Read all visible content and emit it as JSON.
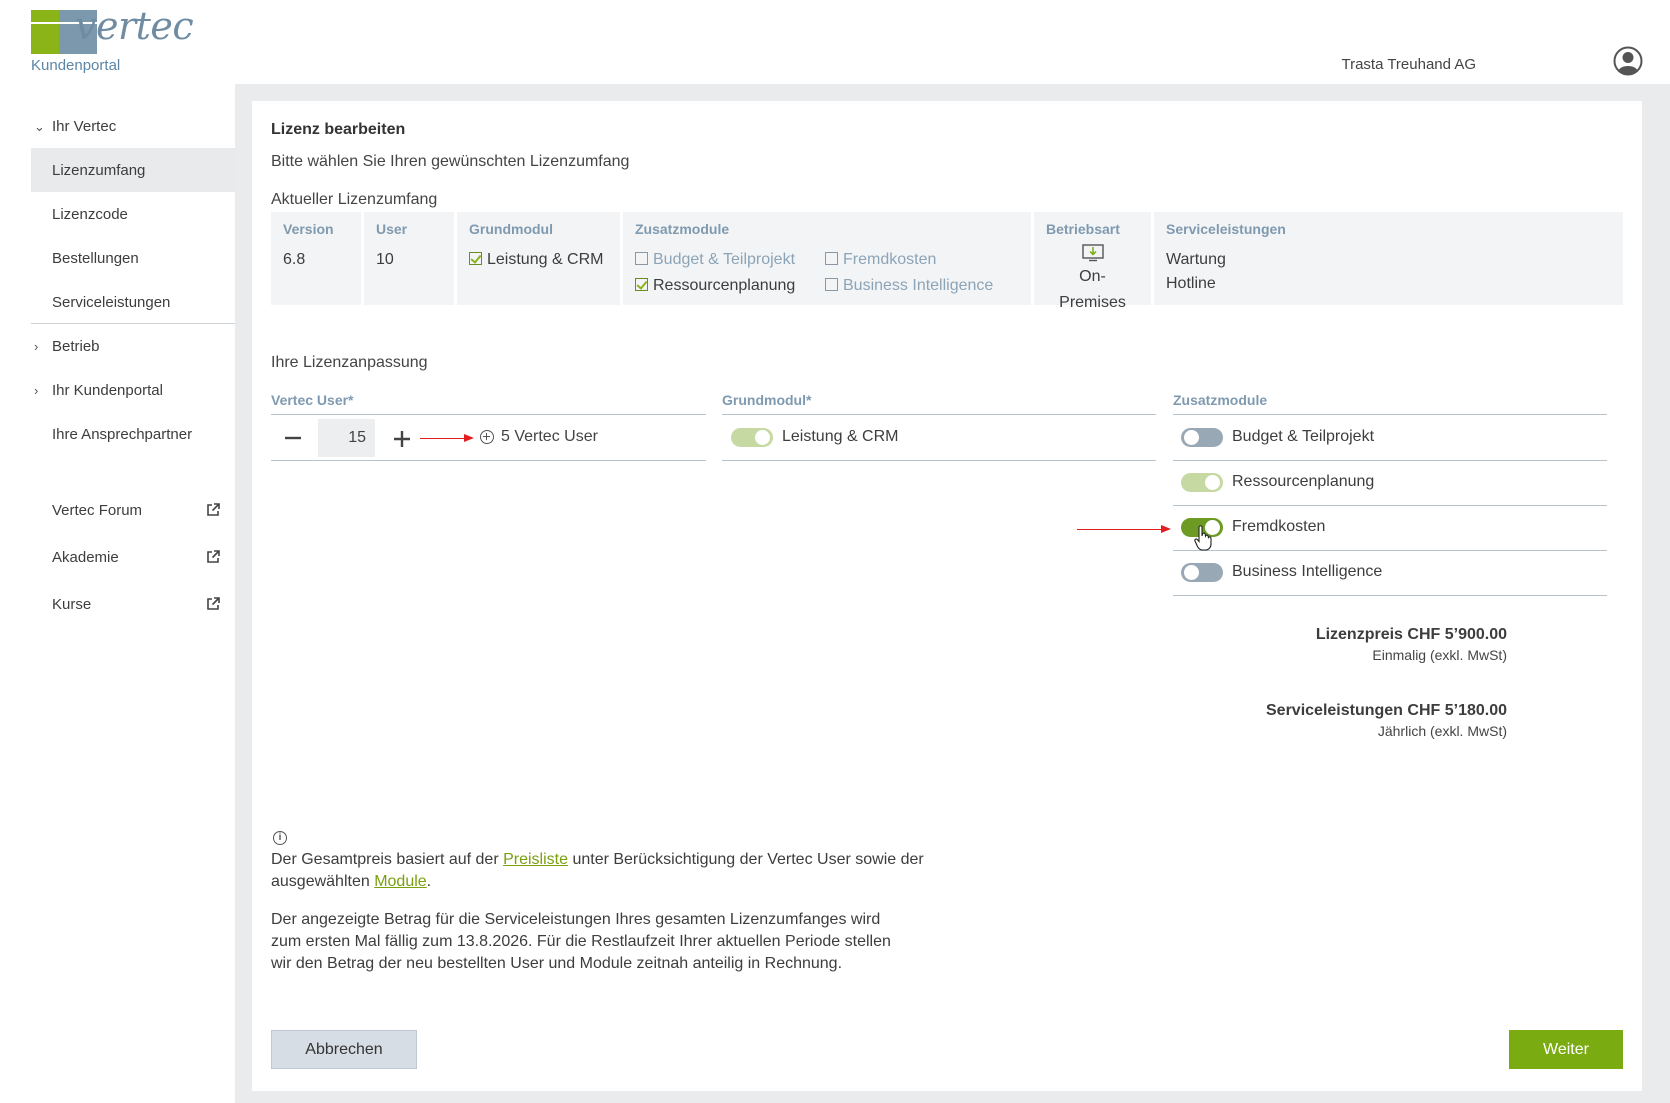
{
  "header": {
    "logo_word": "vertec",
    "portal_label": "Kundenportal",
    "company": "Trasta Treuhand AG"
  },
  "sidebar": {
    "group_ihr_vertec": "Ihr Vertec",
    "items": [
      {
        "label": "Lizenzumfang",
        "active": true
      },
      {
        "label": "Lizenzcode"
      },
      {
        "label": "Bestellungen"
      },
      {
        "label": "Serviceleistungen"
      }
    ],
    "group_betrieb": "Betrieb",
    "group_kundenportal": "Ihr Kundenportal",
    "ansprechpartner": "Ihre Ansprechpartner",
    "external": [
      {
        "label": "Vertec Forum",
        "icon": "external-link-icon"
      },
      {
        "label": "Akademie",
        "icon": "external-link-icon"
      },
      {
        "label": "Kurse",
        "icon": "external-link-icon"
      }
    ]
  },
  "main": {
    "title": "Lizenz bearbeiten",
    "subtitle": "Bitte wählen Sie Ihren gewünschten Lizenzumfang",
    "current_heading": "Aktueller Lizenzumfang",
    "current": {
      "version_label": "Version",
      "version": "6.8",
      "user_label": "User",
      "user": "10",
      "grundmodul_label": "Grundmodul",
      "grundmodul": "Leistung & CRM",
      "zusatz_label": "Zusatzmodule",
      "zusatz": [
        {
          "label": "Budget & Teilprojekt",
          "checked": false
        },
        {
          "label": "Fremdkosten",
          "checked": false
        },
        {
          "label": "Ressourcenplanung",
          "checked": true
        },
        {
          "label": "Business Intelligence",
          "checked": false
        }
      ],
      "betriebsart_label": "Betriebsart",
      "betriebsart": "On-Premises",
      "service_label": "Serviceleistungen",
      "service": [
        "Wartung",
        "Hotline"
      ]
    },
    "adjust_heading": "Ihre Lizenzanpassung",
    "col_user": "Vertec User*",
    "col_grund": "Grundmodul*",
    "col_zusatz": "Zusatzmodule",
    "user_count": "15",
    "user_delta": "5 Vertec User",
    "grund_toggle": "Leistung & CRM",
    "zusatz_toggles": [
      {
        "label": "Budget & Teilprojekt",
        "state": "off"
      },
      {
        "label": "Ressourcenplanung",
        "state": "on-disabled"
      },
      {
        "label": "Fremdkosten",
        "state": "on"
      },
      {
        "label": "Business Intelligence",
        "state": "off"
      }
    ],
    "license_price": "Lizenzpreis CHF 5’900.00",
    "license_price_note": "Einmalig (exkl. MwSt)",
    "service_price": "Serviceleistungen CHF 5’180.00",
    "service_price_note": "Jährlich (exkl. MwSt)",
    "info1_a": "Der Gesamtpreis basiert auf der ",
    "info1_link1": "Preisliste",
    "info1_b": " unter Berücksichtigung der Vertec User sowie der ausgewählten ",
    "info1_link2": "Module",
    "info1_c": ".",
    "info2": "Der angezeigte Betrag für die Serviceleistungen Ihres gesamten Lizenzumfanges wird zum ersten Mal fällig zum 13.8.2026. Für die Restlaufzeit Ihrer aktuellen Periode stellen wir den Betrag der neu bestellten User und Module zeitnah anteilig in Rechnung.",
    "btn_cancel": "Abbrechen",
    "btn_next": "Weiter"
  },
  "colors": {
    "accent_green": "#7aac12",
    "brand_blue": "#7b98ad"
  }
}
